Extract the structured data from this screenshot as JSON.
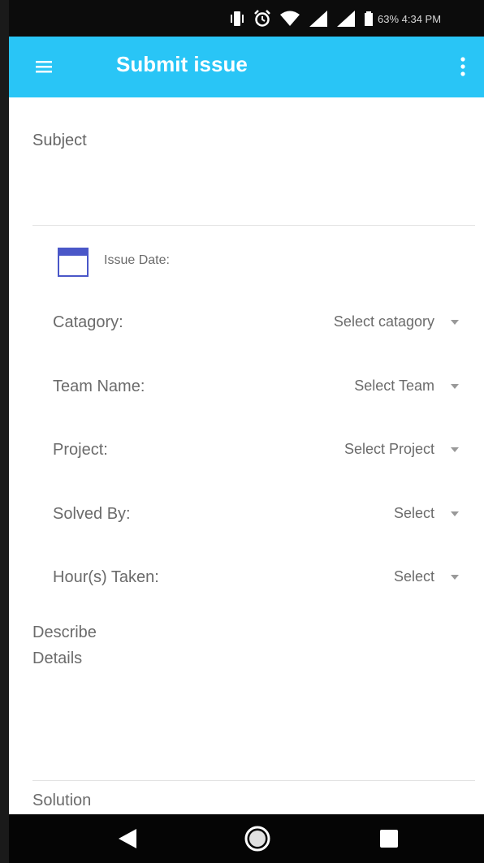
{
  "status_bar": {
    "battery_and_time": "63% 4:34 PM",
    "icons": [
      "vibrate-icon",
      "alarm-icon",
      "wifi-icon",
      "signal-icon",
      "signal-icon",
      "battery-icon"
    ]
  },
  "app_bar": {
    "title": "Submit issue",
    "menu_icon": "hamburger-menu-icon",
    "overflow_icon": "more-vert-icon",
    "background": "#29c5f6"
  },
  "form": {
    "subject_label": "Subject",
    "issue_date_label": "Issue Date:",
    "rows": [
      {
        "label": "Catagory:",
        "value": "Select catagory"
      },
      {
        "label": "Team Name:",
        "value": "Select Team"
      },
      {
        "label": "Project:",
        "value": "Select Project"
      },
      {
        "label": "Solved By:",
        "value": "Select"
      },
      {
        "label": "Hour(s) Taken:",
        "value": "Select"
      }
    ],
    "describe_label_line1": "Describe",
    "describe_label_line2": "Details",
    "solution_label": "Solution"
  },
  "nav_bar": {
    "icons": [
      "back-icon",
      "home-icon",
      "recents-icon"
    ]
  }
}
